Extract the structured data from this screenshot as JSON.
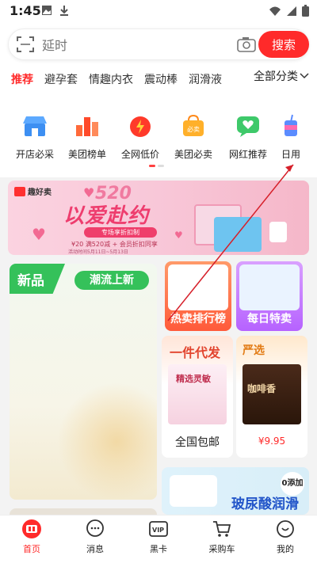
{
  "status_bar": {
    "time": "1:45"
  },
  "search": {
    "placeholder": "延时",
    "button_label": "搜索"
  },
  "category_tabs": [
    {
      "label": "推荐",
      "active": true
    },
    {
      "label": "避孕套"
    },
    {
      "label": "情趣内衣"
    },
    {
      "label": "震动棒"
    },
    {
      "label": "润滑液"
    }
  ],
  "all_categories_label": "全部分类",
  "quick_entries": [
    {
      "label": "开店必采",
      "icon": "store-icon"
    },
    {
      "label": "美团榜单",
      "icon": "ranking-icon"
    },
    {
      "label": "全网低价",
      "icon": "alarm-icon"
    },
    {
      "label": "美团必卖",
      "icon": "bag-icon"
    },
    {
      "label": "网红推荐",
      "icon": "heart-chat-icon"
    },
    {
      "label": "日用",
      "icon": "cup-icon"
    }
  ],
  "banner": {
    "logo_text": "趣好卖",
    "number": "520",
    "title": "以爱赴约",
    "pill": "专场享折扣制",
    "subline": "¥20 满520减 + 会员折扣同享",
    "date": "活动时间5月11日~5月13日"
  },
  "new_products": {
    "label": "新品",
    "tag": "潮流上新"
  },
  "hot_ranking": {
    "title": "热卖排行榜"
  },
  "daily_deal": {
    "title": "每日特卖"
  },
  "dropship": {
    "title": "一件代发",
    "subtitle": "全国包邮",
    "product_text": "精选灵敏"
  },
  "selected": {
    "title": "严选",
    "price": "¥9.95",
    "product_text": "咖啡香"
  },
  "hyaluronic": {
    "title": "玻尿酸润滑",
    "badge": "0添加"
  },
  "bottom_nav": [
    {
      "label": "首页",
      "icon": "home-icon",
      "active": true
    },
    {
      "label": "消息",
      "icon": "message-icon"
    },
    {
      "label": "黑卡",
      "icon": "vip-card-icon"
    },
    {
      "label": "采购车",
      "icon": "cart-icon"
    },
    {
      "label": "我的",
      "icon": "profile-icon"
    }
  ],
  "colors": {
    "accent": "#ff2a2a",
    "green": "#35c15a"
  }
}
